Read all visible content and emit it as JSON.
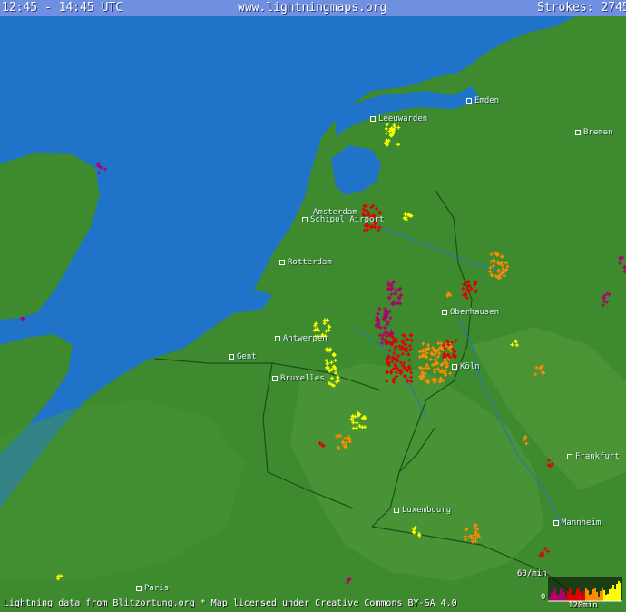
{
  "header": {
    "time_range": "12:45 - 14:45 UTC",
    "site": "www.lightningmaps.org",
    "strokes_label": "Strokes: 2745"
  },
  "cities": [
    {
      "name": "Emden"
    },
    {
      "name": "Leeuwarden"
    },
    {
      "name": "Bremen"
    },
    {
      "name": "Amsterdam"
    },
    {
      "name": "Schipol Airport"
    },
    {
      "name": "Rotterdam"
    },
    {
      "name": "Oberhausen"
    },
    {
      "name": "Antwerpen"
    },
    {
      "name": "Gent"
    },
    {
      "name": "Bruxelles"
    },
    {
      "name": "Köln"
    },
    {
      "name": "Frankfurt"
    },
    {
      "name": "Luxembourg"
    },
    {
      "name": "Mannheim"
    },
    {
      "name": "Paris"
    }
  ],
  "footer": {
    "credit": "Lightning data from Blitzortung.org  *  Map licensed under Creative Commons BY-SA 4.0"
  },
  "legend": {
    "rate_label": "60/min",
    "zero_label": "0",
    "time_label": "120min"
  },
  "colors": {
    "sea": "#1f74c9",
    "land": "#3d8a2f",
    "topbar": "#6f8fe0",
    "strike_recent": "#ffff00",
    "strike_mid": "#ff8c00",
    "strike_older": "#e00000",
    "strike_oldest": "#b0006a"
  }
}
